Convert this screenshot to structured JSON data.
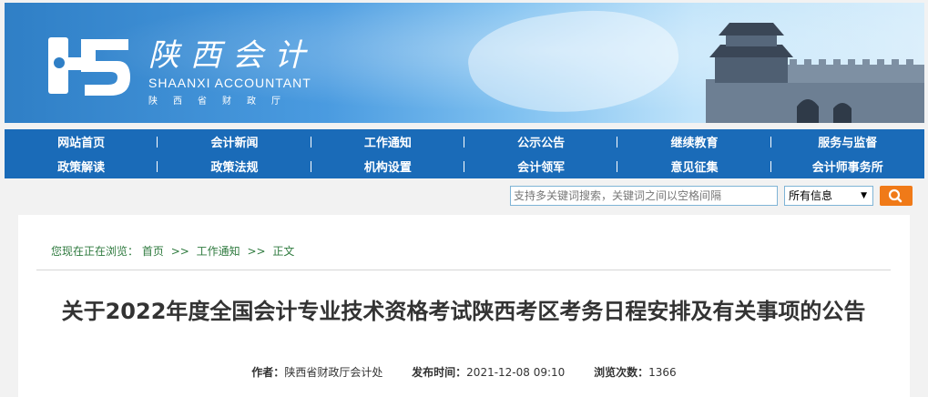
{
  "banner": {
    "brand_cn": "陕西会计",
    "brand_en": "SHAANXI ACCOUNTANT",
    "brand_sub": "陕西省财政厅",
    "colors": {
      "sky_left": "#2f7fc6",
      "sky_right": "#d9eefb"
    }
  },
  "nav": {
    "row1": [
      "网站首页",
      "会计新闻",
      "工作通知",
      "公示公告",
      "继续教育",
      "服务与监督"
    ],
    "row2": [
      "政策解读",
      "政策法规",
      "机构设置",
      "会计领军",
      "意见征集",
      "会计师事务所"
    ],
    "color": "#1a6bb8"
  },
  "search": {
    "placeholder": "支持多关键词搜索，关键词之间以空格间隔",
    "scope_selected": "所有信息",
    "button_icon": "search-icon",
    "button_color": "#f07a18"
  },
  "breadcrumb": {
    "prefix": "您现在正在浏览：",
    "items": [
      "首页",
      "工作通知",
      "正文"
    ],
    "separator": ">>"
  },
  "article": {
    "title": "关于2022年度全国会计专业技术资格考试陕西考区考务日程安排及有关事项的公告",
    "author_label": "作者：",
    "author": "陕西省财政厅会计处",
    "published_label": "发布时间：",
    "published": "2021-12-08 09:10",
    "views_label": "浏览次数：",
    "views": "1366"
  }
}
